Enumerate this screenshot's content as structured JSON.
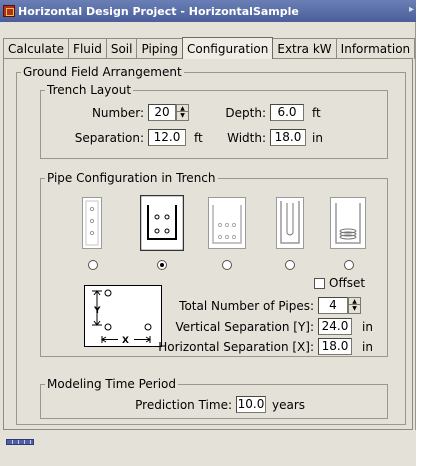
{
  "window": {
    "title": "Horizontal Design Project - HorizontalSample"
  },
  "tabs": [
    {
      "label": "Calculate"
    },
    {
      "label": "Fluid"
    },
    {
      "label": "Soil"
    },
    {
      "label": "Piping"
    },
    {
      "label": "Configuration",
      "active": true
    },
    {
      "label": "Extra kW"
    },
    {
      "label": "Information"
    }
  ],
  "ground_field": {
    "title": "Ground Field Arrangement",
    "trench_layout": {
      "title": "Trench Layout",
      "number_label": "Number:",
      "number_value": "20",
      "separation_label": "Separation:",
      "separation_value": "12.0",
      "separation_unit": "ft",
      "depth_label": "Depth:",
      "depth_value": "6.0",
      "depth_unit": "ft",
      "width_label": "Width:",
      "width_value": "18.0",
      "width_unit": "in"
    },
    "pipe_config": {
      "title": "Pipe Configuration in Trench",
      "selected_index": 1,
      "offset_label": "Offset",
      "offset_checked": false,
      "total_pipes_label": "Total Number of Pipes:",
      "total_pipes_value": "4",
      "vertical_sep_label": "Vertical Separation [Y]:",
      "vertical_sep_value": "24.0",
      "vertical_sep_unit": "in",
      "horizontal_sep_label": "Horizontal Separation [X]:",
      "horizontal_sep_value": "18.0",
      "horizontal_sep_unit": "in",
      "diagram_y_label": "Y",
      "diagram_x_label": "X"
    },
    "modeling": {
      "title": "Modeling Time Period",
      "prediction_label": "Prediction Time:",
      "prediction_value": "10.0",
      "prediction_unit": "years"
    }
  },
  "icons": {
    "app": "app-icon",
    "spinner": "spin-arrows-icon",
    "status": "status-progress-icon"
  }
}
